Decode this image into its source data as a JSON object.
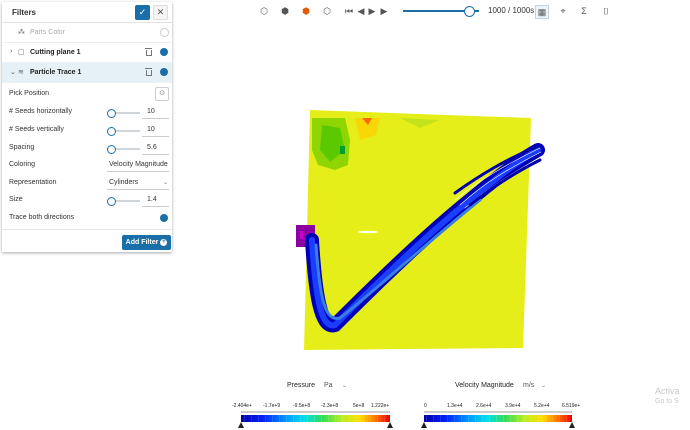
{
  "filters_panel": {
    "title": "Filters",
    "apply_icon": "check-icon",
    "close_icon": "close-icon",
    "tree": [
      {
        "label": "Parts Color",
        "icon": "parts-color-icon",
        "visible": false
      },
      {
        "label": "Cutting plane 1",
        "icon": "cutting-plane-icon",
        "visible": true
      },
      {
        "label": "Particle Trace 1",
        "icon": "particle-trace-icon",
        "visible": true,
        "selected": true
      }
    ],
    "properties": {
      "pick_position": "Pick Position",
      "seeds_h_label": "# Seeds horizontally",
      "seeds_h_value": "10",
      "seeds_v_label": "# Seeds vertically",
      "seeds_v_value": "10",
      "spacing_label": "Spacing",
      "spacing_value": "5.6",
      "coloring_label": "Coloring",
      "coloring_value": "Velocity Magnitude",
      "representation_label": "Representation",
      "representation_value": "Cylinders",
      "size_label": "Size",
      "size_value": "1.4",
      "trace_both_label": "Trace both directions",
      "trace_both_enabled": true
    },
    "add_filter_label": "Add Filter"
  },
  "toolbar": {
    "frame_label": "1000 / 1000s",
    "timeline_progress": 0.85,
    "icons": [
      "cube-outline-icon",
      "cube-solid-icon",
      "cube-colored-icon",
      "cube-wireframe-icon",
      "skip-start-icon",
      "step-back-icon",
      "play-icon",
      "step-forward-icon",
      "chart-icon",
      "probe-icon",
      "sum-icon",
      "camera-icon"
    ]
  },
  "legends": {
    "pressure": {
      "title": "Pressure",
      "unit": "Pa",
      "ticks": [
        "-2.404e+",
        "-1.7e+9",
        "-9.5e+8",
        "-2.3e+8",
        "5e+8",
        "1.222e+"
      ]
    },
    "velocity": {
      "title": "Velocity Magnitude",
      "unit": "m/s",
      "ticks": [
        "0",
        "1.3e+4",
        "2.6e+4",
        "3.9e+4",
        "5.2e+4",
        "6.519e+"
      ]
    }
  },
  "watermark": {
    "line1": "Activa",
    "line2": "Go to S"
  }
}
